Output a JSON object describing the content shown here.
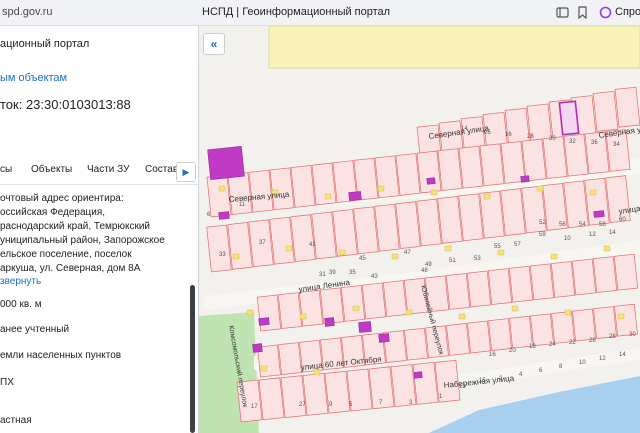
{
  "browser": {
    "url": "spd.gov.ru",
    "tab_title": "НСПД | Геоинформационный портал",
    "right_text": "Спро"
  },
  "panel": {
    "title": "ационный портал",
    "link": "ым объектам",
    "cadastral_number": "ток: 23:30:0103013:88",
    "tabs": [
      "сы",
      "Объекты",
      "Части ЗУ",
      "Состав"
    ],
    "address_lines": [
      "очтовый адрес ориентира:",
      "оссийская Федерация,",
      "раснодарский край, Темрюкский",
      "униципальный район, Запорожское",
      "ельское поселение, поселок",
      "аркуша, ул. Северная, дом 8А"
    ],
    "collapse_link": "звернуть",
    "area": "000 кв. м",
    "status": "анее учтенный",
    "category": "емли населенных пунктов",
    "use": "ПХ",
    "ownership": "астная"
  },
  "map": {
    "streets": [
      "Северная улица",
      "Северная улица",
      "Северная улица",
      "улица",
      "улица Ленина",
      "Комсомольский переулок",
      "улица 60 лет Октября",
      "Юбилейный переулок",
      "Набережная улица"
    ],
    "lot_numbers": [
      "14",
      "26",
      "16",
      "28",
      "30",
      "32",
      "36",
      "34",
      "6",
      "33",
      "11",
      "37",
      "41",
      "39",
      "45",
      "47",
      "49",
      "51",
      "53",
      "55",
      "57",
      "59",
      "10",
      "12",
      "14",
      "31",
      "35",
      "43",
      "48",
      "17",
      "27",
      "9",
      "5",
      "7",
      "3",
      "1",
      "13",
      "15",
      "2",
      "4",
      "6",
      "8",
      "10",
      "12",
      "14",
      "16",
      "20",
      "18",
      "24",
      "22",
      "26",
      "28",
      "30",
      "60",
      "58",
      "54",
      "56",
      "52"
    ],
    "colors": {
      "parcel_fill": "#fbe3e3",
      "parcel_stroke": "#e26a6a",
      "selected_stroke": "#b22bb5",
      "building": "#c03ac6",
      "field": "#f7f2b8",
      "water": "#a9cfee",
      "green": "#bfe3b1"
    }
  }
}
